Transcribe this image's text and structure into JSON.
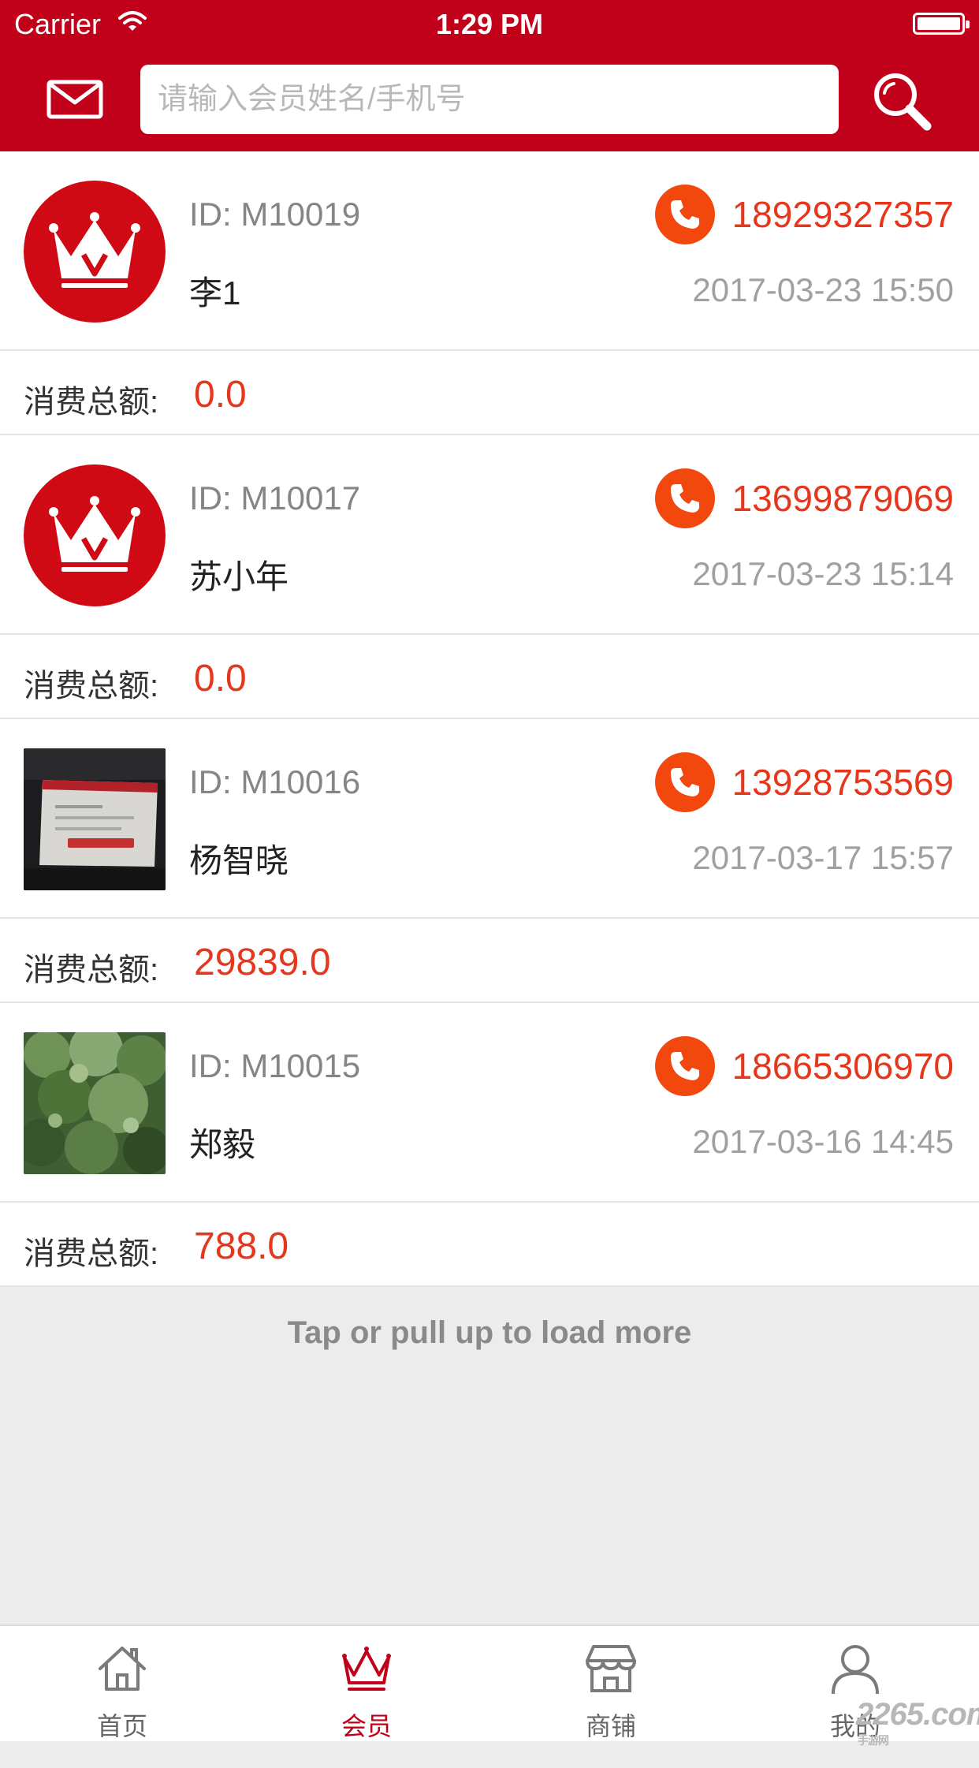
{
  "status_bar": {
    "carrier": "Carrier",
    "time": "1:29 PM"
  },
  "header": {
    "search_placeholder": "请输入会员姓名/手机号"
  },
  "members": [
    {
      "id": "ID: M10019",
      "name": "李1",
      "phone": "18929327357",
      "date": "2017-03-23 15:50",
      "total_label": "消费总额:",
      "total_value": "0.0",
      "avatar": "crown-logo"
    },
    {
      "id": "ID: M10017",
      "name": "苏小年",
      "phone": "13699879069",
      "date": "2017-03-23 15:14",
      "total_label": "消费总额:",
      "total_value": "0.0",
      "avatar": "crown-logo"
    },
    {
      "id": "ID: M10016",
      "name": "杨智晓",
      "phone": "13928753569",
      "date": "2017-03-17 15:57",
      "total_label": "消费总额:",
      "total_value": "29839.0",
      "avatar": "screen-photo"
    },
    {
      "id": "ID: M10015",
      "name": "郑毅",
      "phone": "18665306970",
      "date": "2017-03-16 14:45",
      "total_label": "消费总额:",
      "total_value": "788.0",
      "avatar": "tree-photo"
    }
  ],
  "load_more": "Tap or pull up to load more",
  "tabs": [
    {
      "label": "首页",
      "icon": "home-icon",
      "active": false
    },
    {
      "label": "会员",
      "icon": "crown-icon",
      "active": true
    },
    {
      "label": "商铺",
      "icon": "shop-icon",
      "active": false
    },
    {
      "label": "我的",
      "icon": "user-icon",
      "active": false
    }
  ],
  "watermark": {
    "text": "2265",
    "suffix": ".com",
    "note": "手游网"
  },
  "colors": {
    "brand_red": "#c1001a",
    "accent_orange": "#f2470d",
    "value_red": "#e6361c"
  }
}
